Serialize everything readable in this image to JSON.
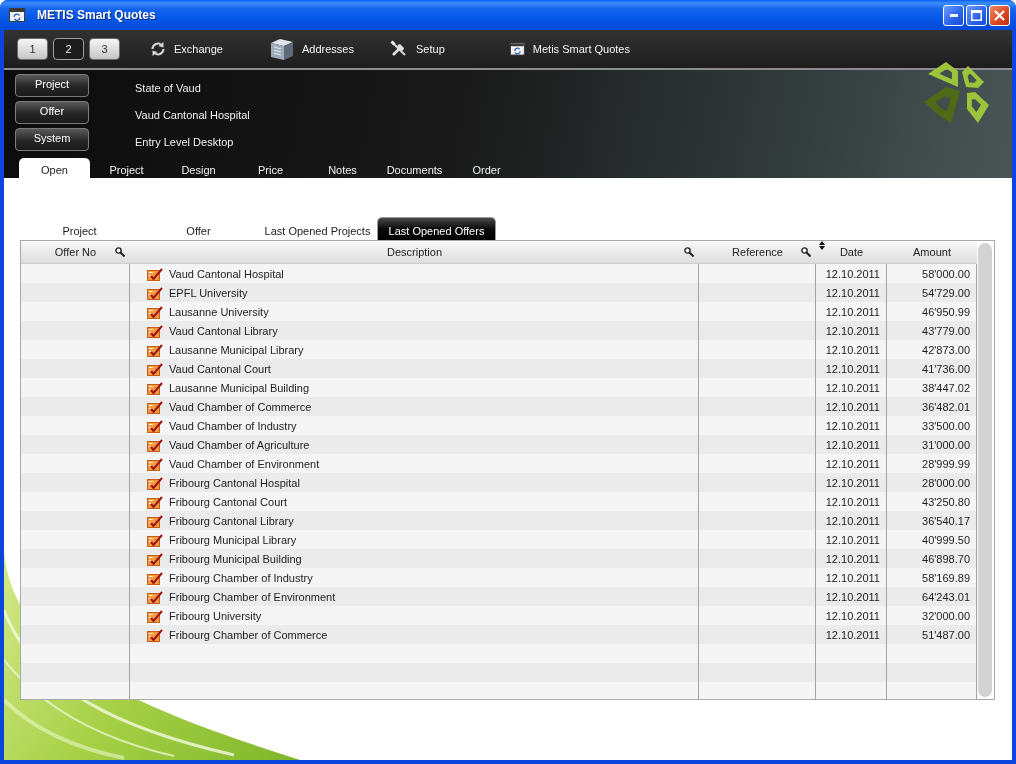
{
  "window": {
    "title": "METIS Smart Quotes"
  },
  "toolbar": {
    "pages": [
      {
        "label": "1",
        "selected": false
      },
      {
        "label": "2",
        "selected": true
      },
      {
        "label": "3",
        "selected": false
      }
    ],
    "items": [
      {
        "label": "Exchange"
      },
      {
        "label": "Addresses"
      },
      {
        "label": "Setup"
      },
      {
        "label": "Metis Smart Quotes"
      }
    ]
  },
  "context": [
    {
      "button": "Project",
      "value": "State of Vaud"
    },
    {
      "button": "Offer",
      "value": "Vaud Cantonal Hospital"
    },
    {
      "button": "System",
      "value": "Entry Level Desktop"
    }
  ],
  "main_tabs": [
    {
      "label": "Open",
      "selected": true
    },
    {
      "label": "Project",
      "selected": false
    },
    {
      "label": "Design",
      "selected": false
    },
    {
      "label": "Price",
      "selected": false
    },
    {
      "label": "Notes",
      "selected": false
    },
    {
      "label": "Documents",
      "selected": false
    },
    {
      "label": "Order",
      "selected": false
    }
  ],
  "sub_tabs": [
    {
      "label": "Project",
      "selected": false
    },
    {
      "label": "Offer",
      "selected": false
    },
    {
      "label": "Last Opened Projects",
      "selected": false
    },
    {
      "label": "Last Opened Offers",
      "selected": true
    }
  ],
  "table": {
    "columns": [
      {
        "label": "Offer No",
        "search": true,
        "sorted": false
      },
      {
        "label": "Description",
        "search": true,
        "sorted": false
      },
      {
        "label": "Reference",
        "search": true,
        "sorted": false
      },
      {
        "label": "Date",
        "search": false,
        "sorted": true
      },
      {
        "label": "Amount",
        "search": false,
        "sorted": false
      }
    ],
    "rows": [
      {
        "description": "Vaud Cantonal Hospital",
        "date": "12.10.2011",
        "amount": "58'000.00"
      },
      {
        "description": "EPFL University",
        "date": "12.10.2011",
        "amount": "54'729.00"
      },
      {
        "description": "Lausanne University",
        "date": "12.10.2011",
        "amount": "46'950.99"
      },
      {
        "description": "Vaud Cantonal Library",
        "date": "12.10.2011",
        "amount": "43'779.00"
      },
      {
        "description": "Lausanne Municipal Library",
        "date": "12.10.2011",
        "amount": "42'873.00"
      },
      {
        "description": "Vaud Cantonal Court",
        "date": "12.10.2011",
        "amount": "41'736.00"
      },
      {
        "description": "Lausanne Municipal Building",
        "date": "12.10.2011",
        "amount": "38'447.02"
      },
      {
        "description": "Vaud Chamber of Commerce",
        "date": "12.10.2011",
        "amount": "36'482.01"
      },
      {
        "description": "Vaud Chamber of Industry",
        "date": "12.10.2011",
        "amount": "33'500.00"
      },
      {
        "description": "Vaud Chamber of Agriculture",
        "date": "12.10.2011",
        "amount": "31'000.00"
      },
      {
        "description": "Vaud Chamber of Environment",
        "date": "12.10.2011",
        "amount": "28'999.99"
      },
      {
        "description": "Fribourg Cantonal Hospital",
        "date": "12.10.2011",
        "amount": "28'000.00"
      },
      {
        "description": "Fribourg Cantonal Court",
        "date": "12.10.2011",
        "amount": "43'250.80"
      },
      {
        "description": "Fribourg Cantonal Library",
        "date": "12.10.2011",
        "amount": "36'540.17"
      },
      {
        "description": "Fribourg Municipal Library",
        "date": "12.10.2011",
        "amount": "40'999.50"
      },
      {
        "description": "Fribourg Municipal Building",
        "date": "12.10.2011",
        "amount": "46'898.70"
      },
      {
        "description": "Fribourg Chamber of Industry",
        "date": "12.10.2011",
        "amount": "58'169.89"
      },
      {
        "description": "Fribourg Chamber of Environment",
        "date": "12.10.2011",
        "amount": "64'243.01"
      },
      {
        "description": "Fribourg University",
        "date": "12.10.2011",
        "amount": "32'000.00"
      },
      {
        "description": "Fribourg Chamber of Commerce",
        "date": "12.10.2011",
        "amount": "51'487.00"
      }
    ]
  }
}
